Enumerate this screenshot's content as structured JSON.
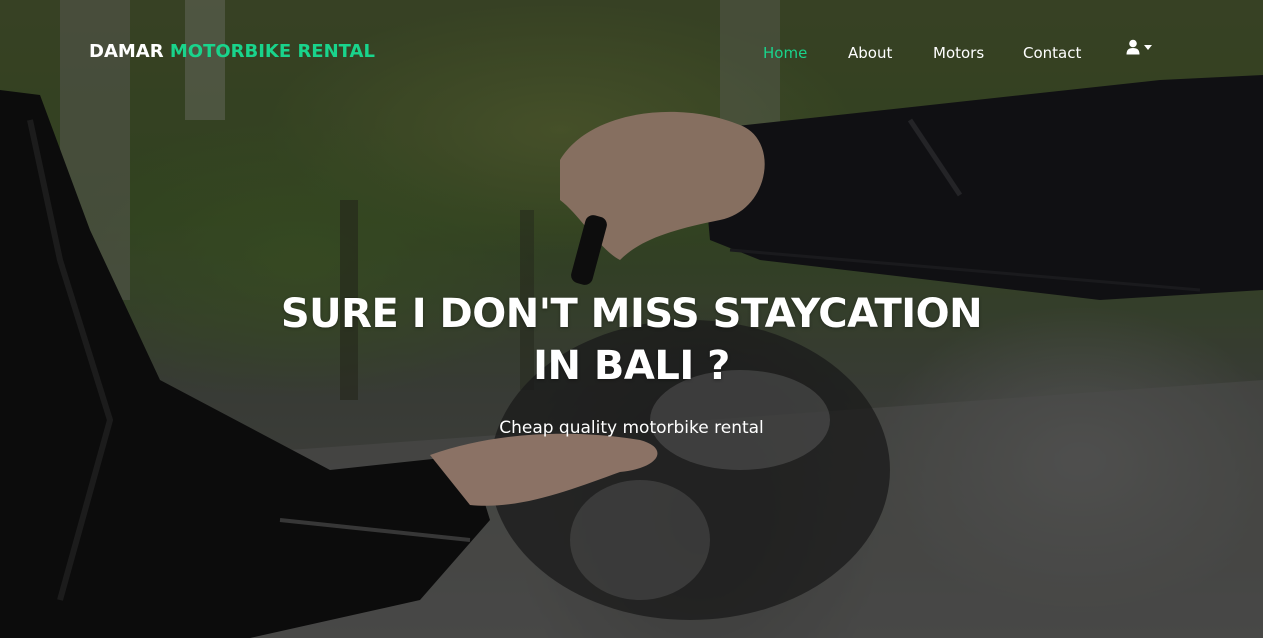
{
  "brand": {
    "part1": "DAMAR",
    "part2": "MOTORBIKE RENTAL"
  },
  "nav": {
    "items": [
      {
        "label": "Home",
        "active": true
      },
      {
        "label": "About",
        "active": false
      },
      {
        "label": "Motors",
        "active": false
      },
      {
        "label": "Contact",
        "active": false
      }
    ],
    "user_icon": "user-icon",
    "dropdown_icon": "caret-down-icon"
  },
  "hero": {
    "title": "SURE I DON'T MISS STAYCATION IN BALI ?",
    "subtitle": "Cheap quality motorbike rental",
    "background": "photo of hands exchanging motorbike key"
  },
  "colors": {
    "accent": "#19d48c",
    "text": "#ffffff"
  }
}
